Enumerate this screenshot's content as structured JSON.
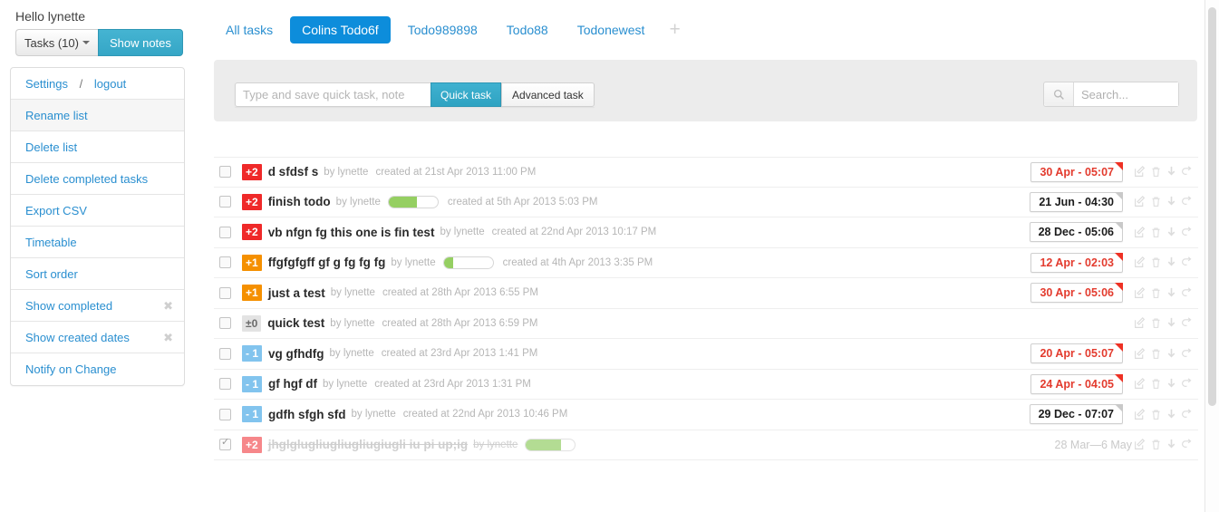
{
  "sidebar": {
    "greeting": "Hello lynette",
    "tasks_button": "Tasks (10)",
    "notes_button": "Show notes",
    "settings_label": "Settings",
    "settings_separator": "/",
    "logout_label": "logout",
    "items": [
      {
        "label": "Rename list",
        "has_x": false
      },
      {
        "label": "Delete list",
        "has_x": false
      },
      {
        "label": "Delete completed tasks",
        "has_x": false
      },
      {
        "label": "Export CSV",
        "has_x": false
      },
      {
        "label": "Timetable",
        "has_x": false
      },
      {
        "label": "Sort order",
        "has_x": false
      },
      {
        "label": "Show completed",
        "has_x": true,
        "x_glyph": "✖"
      },
      {
        "label": "Show created dates",
        "has_x": true,
        "x_glyph": "✖"
      },
      {
        "label": "Notify on Change",
        "has_x": false
      }
    ]
  },
  "tabs": {
    "items": [
      {
        "label": "All tasks",
        "active": false
      },
      {
        "label": "Colins Todo6f",
        "active": true
      },
      {
        "label": "Todo989898",
        "active": false
      },
      {
        "label": "Todo88",
        "active": false
      },
      {
        "label": "Todonewest",
        "active": false
      }
    ],
    "add_glyph": "+"
  },
  "toolbar": {
    "quick_placeholder": "Type and save quick task, note",
    "quick_value": "",
    "quick_task_button": "Quick task",
    "advanced_task_button": "Advanced task",
    "search_placeholder": "Search...",
    "search_value": "",
    "search_icon": "search-icon"
  },
  "tasks": [
    {
      "checked": false,
      "priority": "+2",
      "priority_class": "p2",
      "title": "d sfdsf s",
      "by": "by lynette",
      "created": "created at 21st Apr 2013 11:00 PM",
      "progress": null,
      "date": "30 Apr - 05:07",
      "date_state": "overdue"
    },
    {
      "checked": false,
      "priority": "+2",
      "priority_class": "p2",
      "title": "finish todo",
      "by": "by lynette",
      "created": "created at 5th Apr 2013 5:03 PM",
      "progress": 57,
      "date": "21 Jun - 04:30",
      "date_state": "future"
    },
    {
      "checked": false,
      "priority": "+2",
      "priority_class": "p2",
      "title": "vb nfgn fg this one is fin test",
      "by": "by lynette",
      "created": "created at 22nd Apr 2013 10:17 PM",
      "progress": null,
      "date": "28 Dec - 05:06",
      "date_state": "future"
    },
    {
      "checked": false,
      "priority": "+1",
      "priority_class": "p1",
      "title": "ffgfgfgff gf g fg fg fg",
      "by": "by lynette",
      "created": "created at 4th Apr 2013 3:35 PM",
      "progress": 20,
      "date": "12 Apr - 02:03",
      "date_state": "overdue"
    },
    {
      "checked": false,
      "priority": "+1",
      "priority_class": "p1",
      "title": "just a test",
      "by": "by lynette",
      "created": "created at 28th Apr 2013 6:55 PM",
      "progress": null,
      "date": "30 Apr - 05:06",
      "date_state": "overdue"
    },
    {
      "checked": false,
      "priority": "±0",
      "priority_class": "p0",
      "title": "quick test",
      "by": "by lynette",
      "created": "created at 28th Apr 2013 6:59 PM",
      "progress": null,
      "date": null,
      "date_state": "none"
    },
    {
      "checked": false,
      "priority": "- 1",
      "priority_class": "pm1",
      "title": "vg gfhdfg",
      "by": "by lynette",
      "created": "created at 23rd Apr 2013 1:41 PM",
      "progress": null,
      "date": "20 Apr - 05:07",
      "date_state": "overdue"
    },
    {
      "checked": false,
      "priority": "- 1",
      "priority_class": "pm1",
      "title": "gf hgf df",
      "by": "by lynette",
      "created": "created at 23rd Apr 2013 1:31 PM",
      "progress": null,
      "date": "24 Apr - 04:05",
      "date_state": "overdue"
    },
    {
      "checked": false,
      "priority": "- 1",
      "priority_class": "pm1",
      "title": "gdfh sfgh sfd",
      "by": "by lynette",
      "created": "created at 22nd Apr 2013 10:46 PM",
      "progress": null,
      "date": "29 Dec - 07:07",
      "date_state": "future"
    },
    {
      "checked": true,
      "priority": "+2",
      "priority_class": "done",
      "title": "jhglglugliugliugliugiugli iu pi up;ig",
      "by": "by lynette",
      "created": "",
      "progress": 72,
      "date_range": "28 Mar—6 May",
      "date_state": "range"
    }
  ],
  "row_actions": {
    "edit": "edit-icon",
    "delete": "trash-icon",
    "download": "download-icon",
    "share": "share-icon"
  },
  "colors": {
    "accent_blue": "#0d8ddb",
    "link_blue": "#2a8fd0",
    "teal_button": "#35a6c6",
    "priority_high": "#ef2929",
    "priority_med": "#f59000",
    "priority_zero": "#e3e3e3",
    "priority_low": "#82c4ee",
    "progress_green": "#95cf62",
    "overdue_red": "#e33b2e",
    "toolbar_bg": "#ececec"
  }
}
